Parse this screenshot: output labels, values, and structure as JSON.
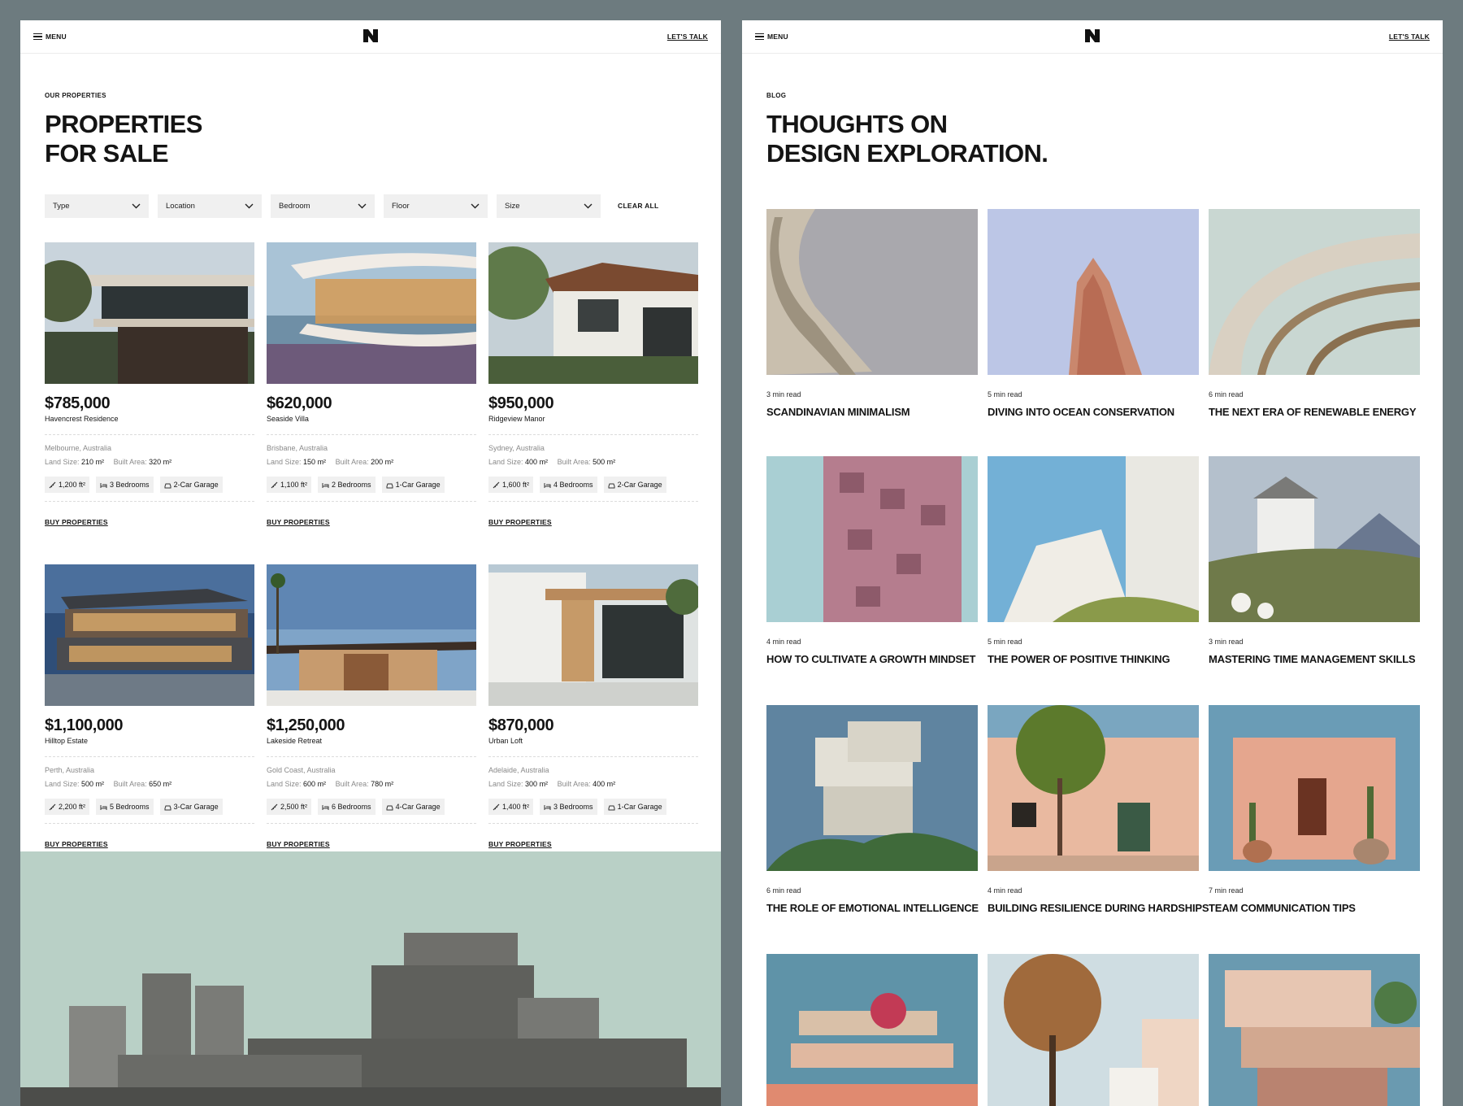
{
  "colors": {
    "background": "#6d7b7f",
    "panel": "#ffffff",
    "chip": "#f0f0f0",
    "text": "#141414"
  },
  "properties_page": {
    "nav": {
      "menu_label": "MENU",
      "logo_icon": "n-logo-icon",
      "cta_label": "LET'S TALK"
    },
    "eyebrow": "OUR PROPERTIES",
    "heading_lines": [
      "PROPERTIES",
      "FOR SALE"
    ],
    "filters": [
      {
        "label": "Type"
      },
      {
        "label": "Location"
      },
      {
        "label": "Bedroom"
      },
      {
        "label": "Floor"
      },
      {
        "label": "Size"
      }
    ],
    "clear_all_label": "CLEAR ALL",
    "listings": [
      {
        "price": "$785,000",
        "name": "Havencrest Residence",
        "location": "Melbourne, Australia",
        "land_label": "Land Size:",
        "land_value": "210 m²",
        "built_label": "Built Area:",
        "built_value": "320 m²",
        "area": "1,200 ft²",
        "bedrooms": "3 Bedrooms",
        "garage": "2-Car Garage",
        "cta": "BUY PROPERTIES"
      },
      {
        "price": "$620,000",
        "name": "Seaside Villa",
        "location": "Brisbane, Australia",
        "land_label": "Land Size:",
        "land_value": "150 m²",
        "built_label": "Built Area:",
        "built_value": "200 m²",
        "area": "1,100 ft²",
        "bedrooms": "2 Bedrooms",
        "garage": "1-Car Garage",
        "cta": "BUY PROPERTIES"
      },
      {
        "price": "$950,000",
        "name": "Ridgeview Manor",
        "location": "Sydney, Australia",
        "land_label": "Land Size:",
        "land_value": "400 m²",
        "built_label": "Built Area:",
        "built_value": "500 m²",
        "area": "1,600 ft²",
        "bedrooms": "4 Bedrooms",
        "garage": "2-Car Garage",
        "cta": "BUY PROPERTIES"
      },
      {
        "price": "$1,100,000",
        "name": "Hilltop Estate",
        "location": "Perth, Australia",
        "land_label": "Land Size:",
        "land_value": "500 m²",
        "built_label": "Built Area:",
        "built_value": "650 m²",
        "area": "2,200 ft²",
        "bedrooms": "5 Bedrooms",
        "garage": "3-Car Garage",
        "cta": "BUY PROPERTIES"
      },
      {
        "price": "$1,250,000",
        "name": "Lakeside Retreat",
        "location": "Gold Coast, Australia",
        "land_label": "Land Size:",
        "land_value": "600 m²",
        "built_label": "Built Area:",
        "built_value": "780 m²",
        "area": "2,500 ft²",
        "bedrooms": "6 Bedrooms",
        "garage": "4-Car Garage",
        "cta": "BUY PROPERTIES"
      },
      {
        "price": "$870,000",
        "name": "Urban Loft",
        "location": "Adelaide, Australia",
        "land_label": "Land Size:",
        "land_value": "300 m²",
        "built_label": "Built Area:",
        "built_value": "400 m²",
        "area": "1,400 ft²",
        "bedrooms": "3 Bedrooms",
        "garage": "1-Car Garage",
        "cta": "BUY PROPERTIES"
      }
    ]
  },
  "blog_page": {
    "nav": {
      "menu_label": "MENU",
      "logo_icon": "n-logo-icon",
      "cta_label": "LET'S TALK"
    },
    "eyebrow": "BLOG",
    "heading_lines": [
      "THOUGHTS ON",
      "DESIGN EXPLORATION."
    ],
    "posts": [
      {
        "read_time": "3 min read",
        "title": "SCANDINAVIAN MINIMALISM"
      },
      {
        "read_time": "5 min read",
        "title": "DIVING INTO OCEAN CONSERVATION"
      },
      {
        "read_time": "6 min read",
        "title": "THE NEXT ERA OF RENEWABLE ENERGY"
      },
      {
        "read_time": "4 min read",
        "title": "HOW TO CULTIVATE A GROWTH MINDSET"
      },
      {
        "read_time": "5 min read",
        "title": "THE POWER OF POSITIVE THINKING"
      },
      {
        "read_time": "3 min read",
        "title": "MASTERING TIME MANAGEMENT SKILLS"
      },
      {
        "read_time": "6 min read",
        "title": "THE ROLE OF EMOTIONAL INTELLIGENCE"
      },
      {
        "read_time": "4 min read",
        "title": "BUILDING RESILIENCE DURING HARDSHIPS"
      },
      {
        "read_time": "7 min read",
        "title": "TEAM COMMUNICATION TIPS"
      },
      {
        "read_time": "",
        "title": ""
      },
      {
        "read_time": "",
        "title": ""
      },
      {
        "read_time": "",
        "title": ""
      }
    ]
  }
}
